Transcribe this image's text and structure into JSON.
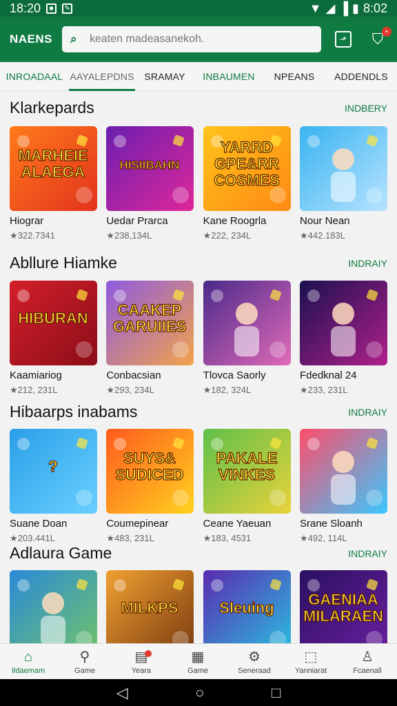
{
  "status": {
    "time": "18:20",
    "battery_time": "8:02"
  },
  "header": {
    "title": "NAENS",
    "search_placeholder": "keaten madeasanekoh."
  },
  "tabs": [
    {
      "label": "INROADAAL"
    },
    {
      "label": "AAYALEPDNS"
    },
    {
      "label": "SRAMAY"
    },
    {
      "label": "INBAUMEN"
    },
    {
      "label": "NPEANS"
    },
    {
      "label": "ADDENDLS"
    }
  ],
  "sections": [
    {
      "title": "Klarkepards",
      "more": "INDBERY",
      "items": [
        {
          "title": "Hiograr",
          "meta": "★322.7341",
          "art": "MARHEIE ALAEGA",
          "c1": "#ff7a1a",
          "c2": "#e2331d"
        },
        {
          "title": "Uedar Prarca",
          "meta": "★238,134L",
          "art": "HISIIBAHN",
          "c1": "#6a1fb0",
          "c2": "#e0279a"
        },
        {
          "title": "Kane Roogrla",
          "meta": "★222, 234L",
          "art": "YARRD GPE&RR COSMES",
          "c1": "#ffc31a",
          "c2": "#ff8a14"
        },
        {
          "title": "Nour Nean",
          "meta": "★442.183L",
          "art": "",
          "c1": "#38b4f0",
          "c2": "#b7e3ff"
        }
      ]
    },
    {
      "title": "Abllure Hiamke",
      "more": "INDRAIY",
      "items": [
        {
          "title": "Kaamiariog",
          "meta": "★212, 231L",
          "art": "HIBURAN",
          "c1": "#d31f2b",
          "c2": "#8c0e18"
        },
        {
          "title": "Conbacsian",
          "meta": "★293, 234L",
          "art": "CAAKEP GARUIIES",
          "c1": "#8e5ae0",
          "c2": "#f2a34b"
        },
        {
          "title": "Tlovca Saorly",
          "meta": "★182, 324L",
          "art": "",
          "c1": "#4a2a8a",
          "c2": "#e06ab8"
        },
        {
          "title": "Fdedknal 24",
          "meta": "★233, 231L",
          "art": "",
          "c1": "#1a1050",
          "c2": "#b0208a"
        }
      ]
    },
    {
      "title": "Hibaarps inabams",
      "more": "INDRAIY",
      "items": [
        {
          "title": "Suane Doan",
          "meta": "★203.441L",
          "art": "?",
          "c1": "#2a9fe8",
          "c2": "#69d0ff"
        },
        {
          "title": "Coumepinear",
          "meta": "★483, 231L",
          "art": "SUYS& SUDICED",
          "c1": "#ff5a1e",
          "c2": "#ffd21f"
        },
        {
          "title": "Ceane Yaeuan",
          "meta": "★183, 4531",
          "art": "PAKALE VINKES",
          "c1": "#5fc04a",
          "c2": "#e8d23a"
        },
        {
          "title": "Srane Sloanh",
          "meta": "★492, 114L",
          "art": "",
          "c1": "#ff4d6a",
          "c2": "#3ac8ff"
        }
      ]
    },
    {
      "title": "Adlaura Game",
      "more": "INDRAIY",
      "items": [
        {
          "title": "",
          "meta": "",
          "art": "",
          "c1": "#2a8ad8",
          "c2": "#70c36a"
        },
        {
          "title": "",
          "meta": "",
          "art": "MILKPS",
          "c1": "#f0a030",
          "c2": "#7a3a10"
        },
        {
          "title": "",
          "meta": "",
          "art": "Sleuing",
          "c1": "#5a2ab0",
          "c2": "#2ac0e0"
        },
        {
          "title": "",
          "meta": "",
          "art": "GAENIAA MILARAEN",
          "c1": "#2a1060",
          "c2": "#6a20a0"
        }
      ]
    }
  ],
  "bottom_nav": [
    {
      "label": "Ildaemam",
      "icon": "home-icon"
    },
    {
      "label": "Game",
      "icon": "search-icon"
    },
    {
      "label": "Yeara",
      "icon": "chart-icon"
    },
    {
      "label": "Game",
      "icon": "grid-icon"
    },
    {
      "label": "Seneraad",
      "icon": "gear-icon"
    },
    {
      "label": "Yanniarat",
      "icon": "box-icon"
    },
    {
      "label": "Fcaenall",
      "icon": "person-icon"
    }
  ],
  "colors": {
    "brand": "#0f7a42",
    "badge": "#e23a2e"
  }
}
